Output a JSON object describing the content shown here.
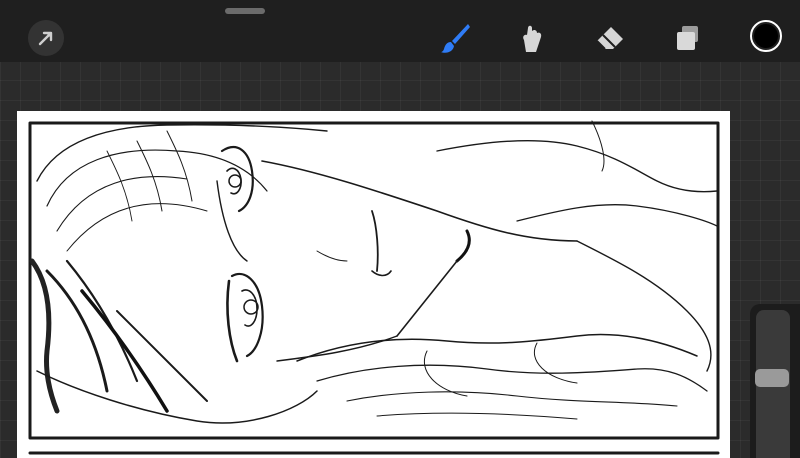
{
  "toolbar": {
    "tools": [
      {
        "name": "actions",
        "icon": "arrow-icon",
        "active": false
      },
      {
        "name": "brush",
        "icon": "brush-icon",
        "active": true
      },
      {
        "name": "smudge",
        "icon": "smudge-icon",
        "active": false
      },
      {
        "name": "eraser",
        "icon": "eraser-icon",
        "active": false
      },
      {
        "name": "layers",
        "icon": "layers-icon",
        "active": false
      }
    ],
    "active_color": "#000000",
    "accent_color": "#2f7cf6"
  },
  "sidebar": {
    "brush_size_level": 0.55
  },
  "canvas": {
    "background": "#ffffff",
    "content": "sketch-artwork"
  }
}
